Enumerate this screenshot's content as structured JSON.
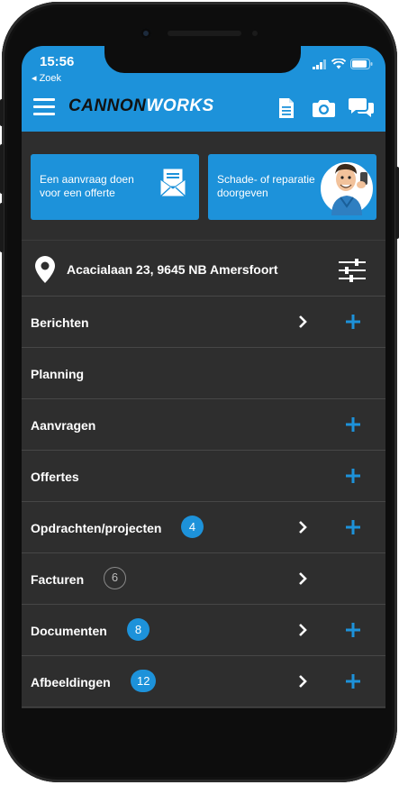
{
  "status_bar": {
    "time": "15:56",
    "back_label": "◂ Zoek"
  },
  "header": {
    "logo_part1": "CANNON",
    "logo_part2": "WORKS",
    "icons": [
      "document-icon",
      "camera-icon",
      "chat-icon"
    ]
  },
  "cards": {
    "request": {
      "line1": "Een aanvraag doen",
      "line2": "voor een offerte"
    },
    "damage": {
      "line1": "Schade- of reparatie",
      "line2": "doorgeven"
    }
  },
  "address": {
    "text": "Acacialaan 23, 9645 NB Amersfoort"
  },
  "menu": {
    "items": [
      {
        "label": "Berichten",
        "badge": "",
        "chevron": true,
        "plus": true
      },
      {
        "label": "Planning",
        "badge": "",
        "chevron": false,
        "plus": false
      },
      {
        "label": "Aanvragen",
        "badge": "",
        "chevron": false,
        "plus": true
      },
      {
        "label": "Offertes",
        "badge": "",
        "chevron": false,
        "plus": true
      },
      {
        "label": "Opdrachten/projecten",
        "badge": "4",
        "badge_style": "filled",
        "chevron": true,
        "plus": true
      },
      {
        "label": "Facturen",
        "badge": "6",
        "badge_style": "outline",
        "chevron": true,
        "plus": false
      },
      {
        "label": "Documenten",
        "badge": "8",
        "badge_style": "filled",
        "chevron": true,
        "plus": true
      },
      {
        "label": "Afbeeldingen",
        "badge": "12",
        "badge_style": "filled",
        "chevron": true,
        "plus": true
      }
    ]
  },
  "colors": {
    "accent": "#1d92da",
    "background": "#2e2e2e",
    "divider": "#474747"
  }
}
